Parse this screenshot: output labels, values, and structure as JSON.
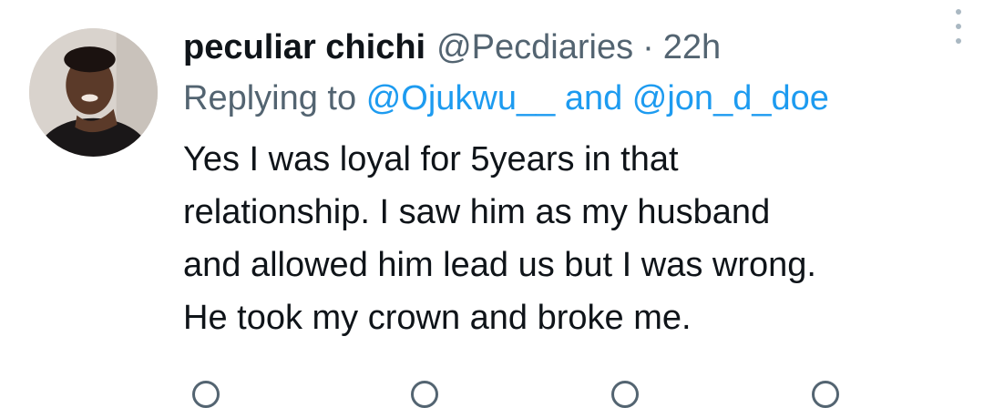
{
  "tweet": {
    "author_name": "peculiar chichi",
    "author_handle": "@Pecdiaries",
    "separator": "·",
    "time": "22h",
    "reply": {
      "prefix": "Replying to",
      "mentions": [
        "@Ojukwu__",
        "@jon_d_doe"
      ],
      "conjunction": "and"
    },
    "text": "Yes I was loyal for 5years in that\nrelationship. I saw him as my husband\nand allowed him lead us but I was wrong.\nHe took my crown and broke me."
  },
  "icons": {
    "avatar": "profile-photo",
    "more": "vertical-ellipsis-icon"
  },
  "colors": {
    "text": "#0f1419",
    "secondary": "#536471",
    "link": "#1d9bf0",
    "background": "#ffffff"
  }
}
